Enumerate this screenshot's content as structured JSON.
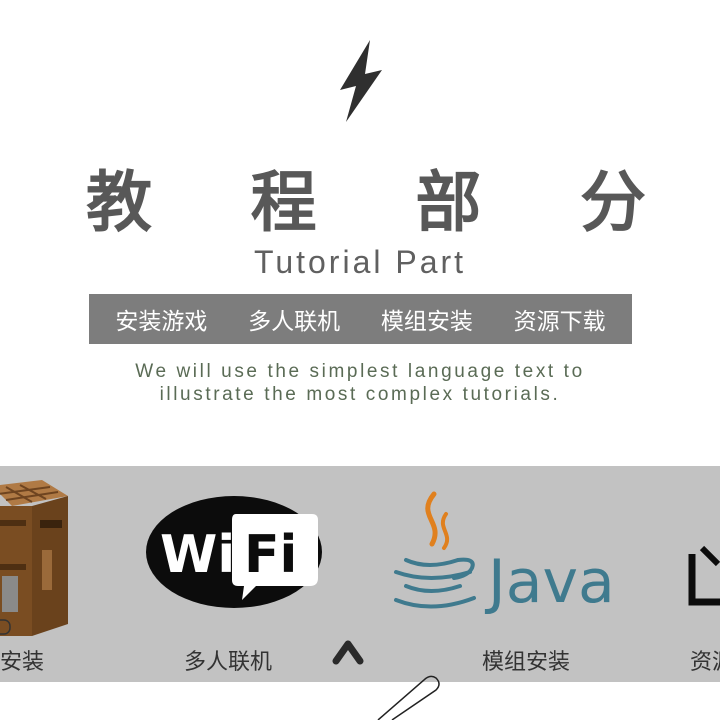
{
  "header": {
    "title_chars": [
      "教",
      "程",
      "部",
      "分"
    ],
    "subtitle": "Tutorial Part",
    "description_lines": [
      "We will use the simplest language text to",
      "illustrate the most complex tutorials."
    ]
  },
  "nav": {
    "items": [
      "安装游戏",
      "多人联机",
      "模组安装",
      "资源下载"
    ]
  },
  "carousel": {
    "items": [
      {
        "icon": "crafting-table-icon",
        "label": "安装"
      },
      {
        "icon": "wifi-logo-icon",
        "label": "多人联机"
      },
      {
        "icon": "java-logo-icon",
        "label": "模组安装",
        "logo_text": "Java"
      },
      {
        "icon": "download-icon",
        "label": "资源"
      }
    ],
    "wifi_text": {
      "wi": "Wi",
      "fi": "Fi"
    }
  },
  "colors": {
    "title": "#585858",
    "nav_bg": "#7d7d7d",
    "strip_bg": "#c2c2c2",
    "java_blue": "#3f7a8e",
    "java_orange": "#e0801e"
  }
}
